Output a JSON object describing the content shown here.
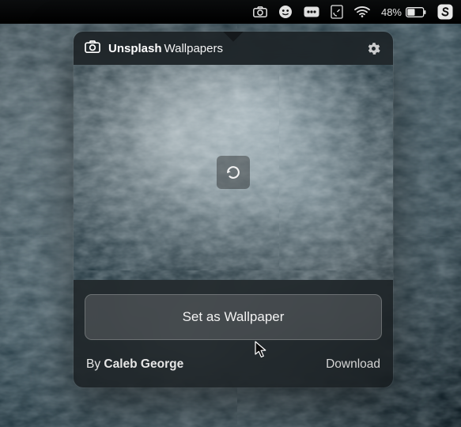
{
  "menubar": {
    "battery_percent": "48%",
    "icons": [
      "camera-icon",
      "face-icon",
      "more-icon",
      "rect4-icon",
      "wifi-icon",
      "battery-icon",
      "app-s-icon"
    ]
  },
  "panel": {
    "brand_name": "Unsplash",
    "brand_sub": "Wallpapers",
    "set_button_label": "Set as Wallpaper",
    "credit_prefix": "By ",
    "credit_author": "Caleb George",
    "download_label": "Download"
  }
}
